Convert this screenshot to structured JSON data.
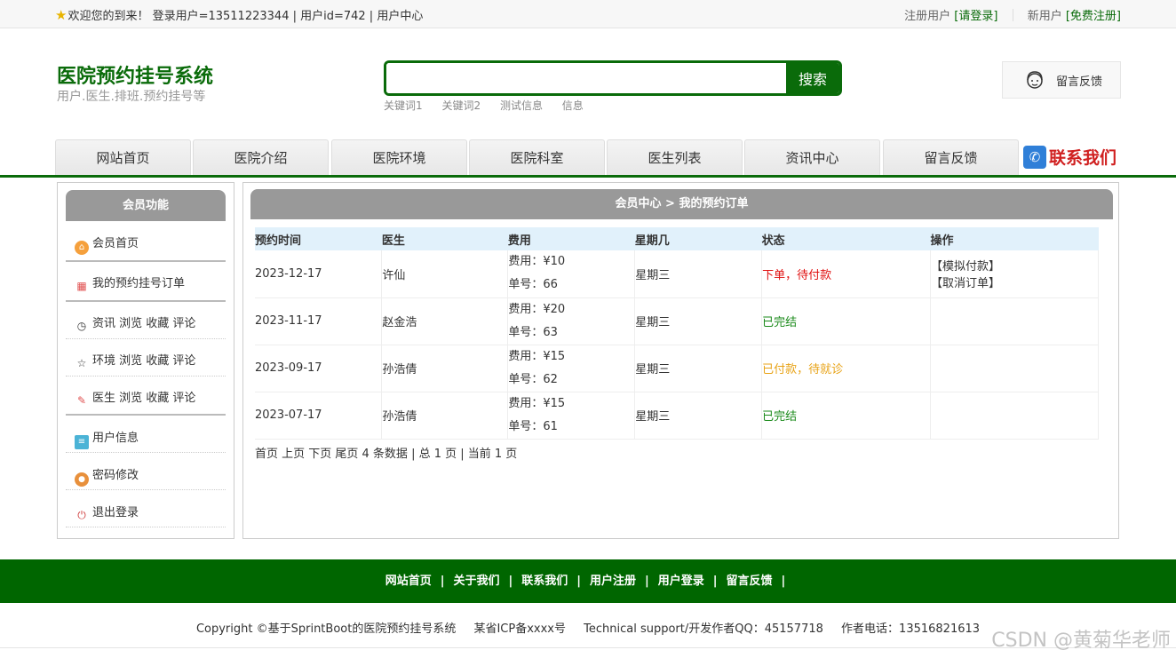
{
  "topbar": {
    "welcome": "欢迎您的到来！ 登录用户=13511223344 | 用户id=742 | 用户中心",
    "register_prefix": "注册用户",
    "login_link": "[请登录]",
    "new_prefix": "新用户",
    "register_link": "[免费注册]"
  },
  "header": {
    "title": "医院预约挂号系统",
    "subtitle": "用户.医生.排班.预约挂号等",
    "search_button": "搜索",
    "keywords": [
      "关键词1",
      "关键词2",
      "测试信息",
      "信息"
    ],
    "feedback": "留言反馈"
  },
  "nav": {
    "items": [
      "网站首页",
      "医院介绍",
      "医院环境",
      "医院科室",
      "医生列表",
      "资讯中心",
      "留言反馈"
    ],
    "contact": "联系我们"
  },
  "sidebar": {
    "title": "会员功能",
    "items": [
      {
        "label": "会员首页"
      },
      {
        "label": "我的预约挂号订单"
      },
      {
        "label": "资讯 浏览 收藏 评论"
      },
      {
        "label": "环境 浏览 收藏 评论"
      },
      {
        "label": "医生 浏览 收藏 评论"
      },
      {
        "label": "用户信息"
      },
      {
        "label": "密码修改"
      },
      {
        "label": "退出登录"
      }
    ]
  },
  "main": {
    "breadcrumb": "会员中心 > 我的预约订单",
    "columns": [
      "预约时间",
      "医生",
      "费用",
      "星期几",
      "状态",
      "操作"
    ],
    "rows": [
      {
        "date": "2023-12-17",
        "doctor": "许仙",
        "fee": "费用：¥10",
        "order_no": "单号：66",
        "weekday": "星期三",
        "status": "下单，待付款",
        "status_color": "#e01010",
        "actions": [
          "【模拟付款】",
          "【取消订单】"
        ]
      },
      {
        "date": "2023-11-17",
        "doctor": "赵金浩",
        "fee": "费用：¥20",
        "order_no": "单号：63",
        "weekday": "星期三",
        "status": "已完结",
        "status_color": "#1a8a1a",
        "actions": []
      },
      {
        "date": "2023-09-17",
        "doctor": "孙浩倩",
        "fee": "费用：¥15",
        "order_no": "单号：62",
        "weekday": "星期三",
        "status": "已付款，待就诊",
        "status_color": "#e8a317",
        "actions": []
      },
      {
        "date": "2023-07-17",
        "doctor": "孙浩倩",
        "fee": "费用：¥15",
        "order_no": "单号：61",
        "weekday": "星期三",
        "status": "已完结",
        "status_color": "#1a8a1a",
        "actions": []
      }
    ],
    "pager": "首页 上页 下页 尾页 4 条数据 | 总 1 页 | 当前 1 页"
  },
  "footer": {
    "links": [
      "网站首页",
      "关于我们",
      "联系我们",
      "用户注册",
      "用户登录",
      "留言反馈"
    ],
    "copyright": "Copyright ©基于SprintBoot的医院预约挂号系统",
    "icp": "某省ICP备xxxx号",
    "support": "Technical support/开发作者QQ：45157718",
    "phone": "作者电话：13516821613"
  },
  "watermark": "CSDN @黄菊华老师",
  "colors": {
    "brand_green": "#0a6b0a",
    "footer_green": "#006600",
    "header_gray": "#999999",
    "table_head": "#e1f1fb"
  }
}
